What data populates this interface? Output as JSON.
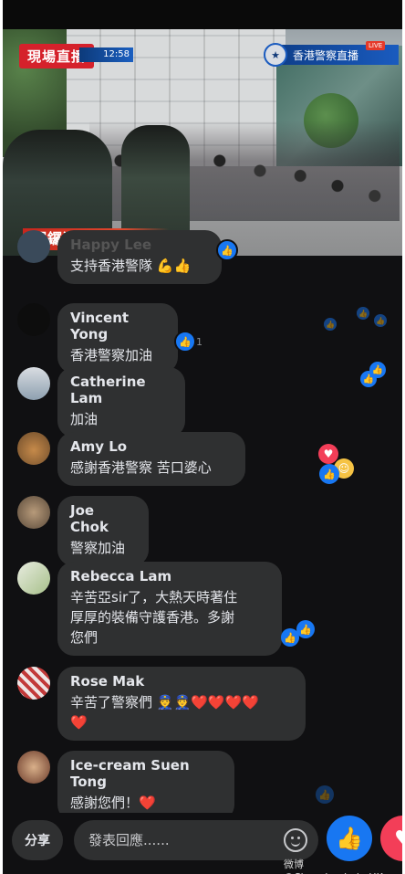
{
  "video": {
    "live_badge": "現場直播",
    "time": "12:58",
    "channel": "香港警察直播",
    "live_tag": "LIVE",
    "location": "銅鑼灣現場"
  },
  "comments": [
    {
      "name": "Happy Lee",
      "text": "支持香港警隊 💪👍",
      "likes": ""
    },
    {
      "name": "Vincent Yong",
      "text": "香港警察加油",
      "likes": "1"
    },
    {
      "name": "Catherine Lam",
      "text": "加油",
      "likes": ""
    },
    {
      "name": "Amy Lo",
      "text": "感謝香港警察 苦口婆心",
      "likes": ""
    },
    {
      "name": "Joe Chok",
      "text": "警察加油",
      "likes": ""
    },
    {
      "name": "Rebecca Lam",
      "text_lines": [
        "辛苦亞sir了，大熱天時著住",
        "厚厚的裝備守護香港。多謝",
        "您們"
      ],
      "likes": ""
    },
    {
      "name": "Rose Mak",
      "text_lines": [
        "辛苦了警察們 👮👮❤️❤️❤️❤️",
        "❤️"
      ],
      "likes": ""
    },
    {
      "name": "Ice-cream Suen Tong",
      "text": "感謝您們！❤️",
      "likes": ""
    }
  ],
  "footer": {
    "share_label": "分享",
    "reply_placeholder": "發表回應......",
    "watermark": "微博 @ChanchanbabyHK"
  },
  "icons": {
    "like": "like-icon",
    "love": "love-icon",
    "emoji": "emoji-icon"
  },
  "colors": {
    "facebook_blue": "#1877f2",
    "love_red": "#f33e58",
    "bubble": "#2f3031",
    "live_red": "#d5212b"
  }
}
